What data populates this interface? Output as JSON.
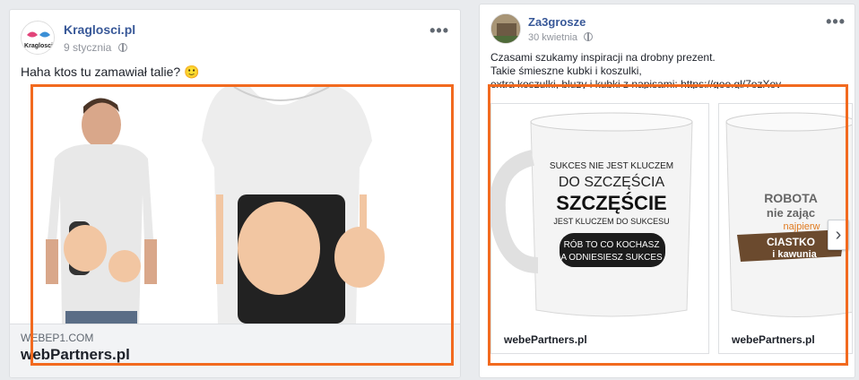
{
  "left_post": {
    "author": "Kraglosci.pl",
    "avatar_text": "Kraglosci",
    "date": "9 stycznia",
    "more": "•••",
    "text": "Haha ktos tu zamawiał talie? 🙂",
    "link_domain": "WEBEP1.COM",
    "link_title": "webPartners.pl"
  },
  "right_post": {
    "author": "Za3grosze",
    "date": "30 kwietnia",
    "more": "•••",
    "text_line1": "Czasami szukamy inspiracji na drobny prezent.",
    "text_line2": "Takie śmieszne kubki i koszulki,",
    "text_line3": "extra koszulki, bluzy i kubki z napisami: https://goo.gl/7ozXov",
    "cards": [
      {
        "label": "webePartners.pl",
        "mug_lines": [
          "SUKCES NIE JEST KLUCZEM",
          "DO SZCZĘŚCIA",
          "SZCZĘŚCIE",
          "JEST KLUCZEM DO SUKCESU",
          "RÓB TO CO KOCHASZ",
          "A ODNIESIESZ SUKCES"
        ]
      },
      {
        "label": "webePartners.pl",
        "mug_lines": [
          "ROBOTA",
          "nie zając",
          "najpierw",
          "CIASTKO",
          "i kawunia"
        ]
      }
    ],
    "next_arrow": "›"
  },
  "colors": {
    "highlight": "#f26a1f",
    "link_blue": "#385898",
    "background": "#e9ebee"
  }
}
